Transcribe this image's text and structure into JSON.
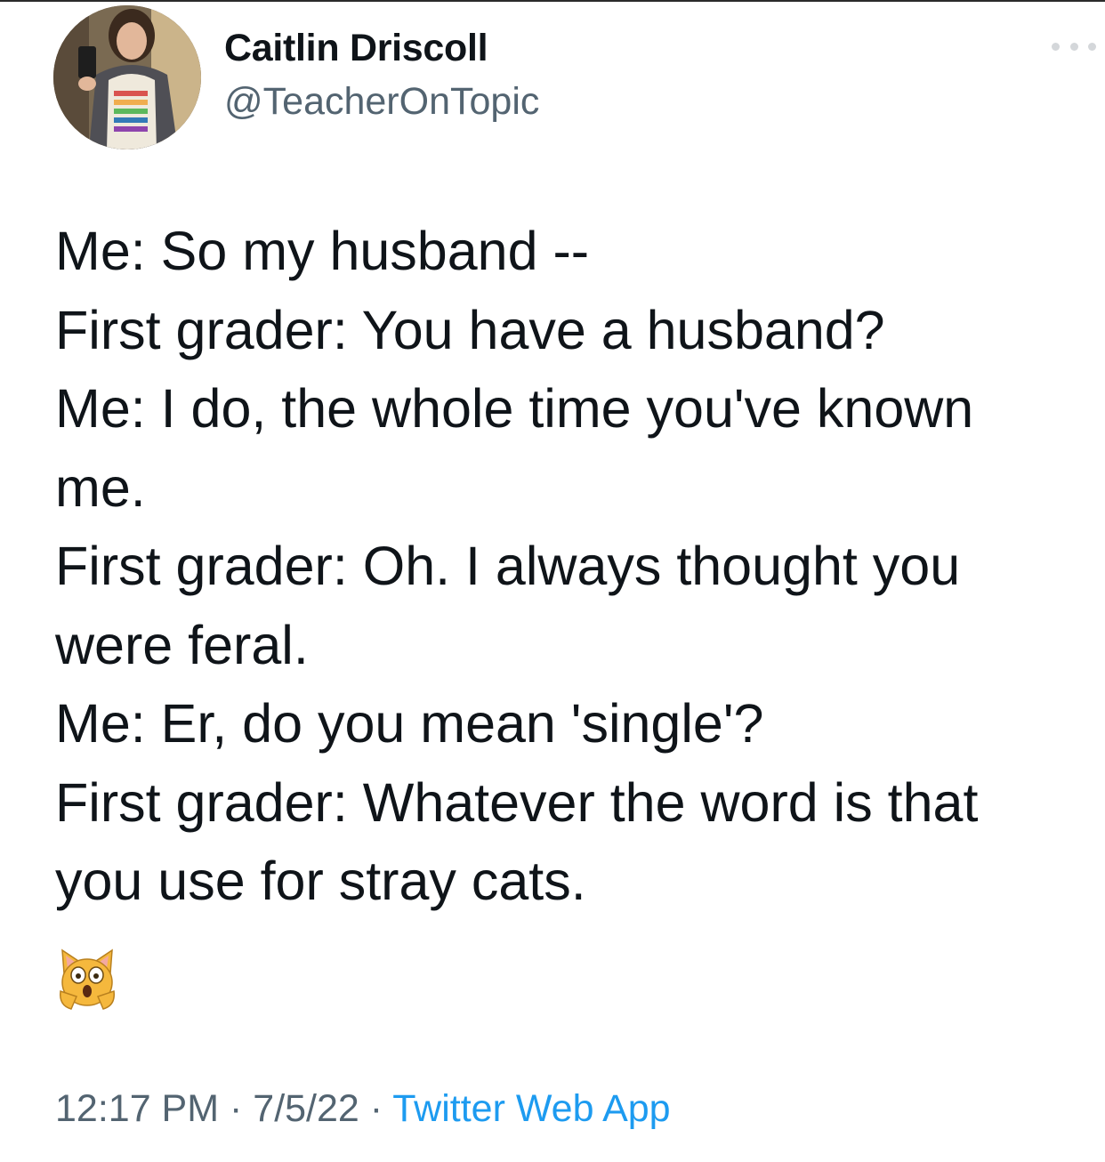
{
  "author": {
    "display_name": "Caitlin Driscoll",
    "handle": "@TeacherOnTopic",
    "avatar_icon": "profile-photo-icon"
  },
  "menu": {
    "icon": "more-options-icon"
  },
  "tweet": {
    "lines": [
      "Me: So my husband --",
      "First grader: You have a husband?",
      "Me: I do, the whole time you've known",
      "me.",
      "First grader: Oh. I always thought you",
      "were feral.",
      "Me: Er, do you mean 'single'?",
      "First grader: Whatever the word is that",
      "you use for stray cats."
    ],
    "emoji": "weary-cat-face-icon"
  },
  "meta": {
    "time": "12:17 PM",
    "separator": " · ",
    "date": "7/5/22",
    "source": "Twitter Web App"
  },
  "colors": {
    "text": "#0f1419",
    "secondary": "#536471",
    "link": "#1d9bf0"
  }
}
